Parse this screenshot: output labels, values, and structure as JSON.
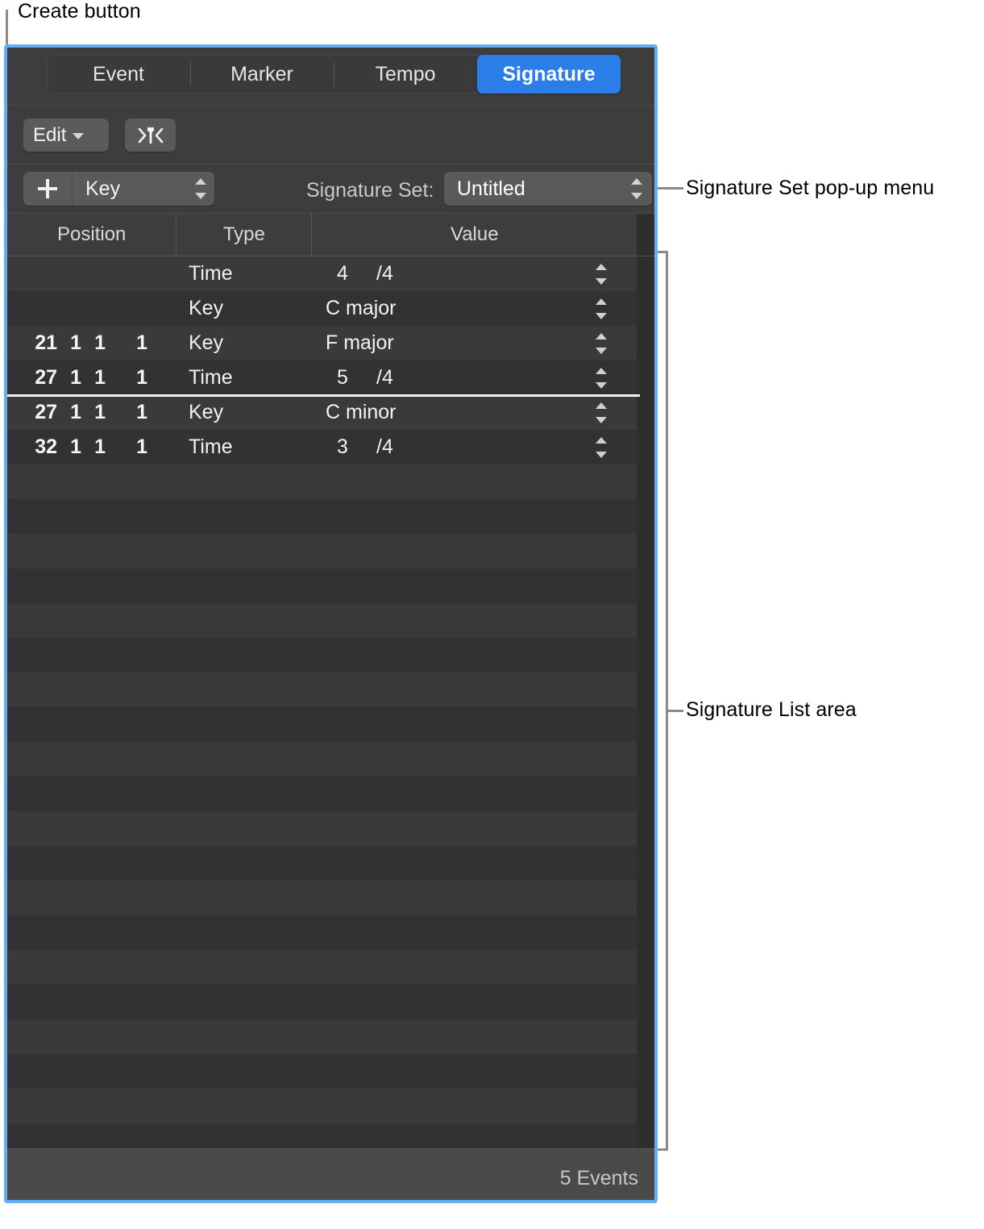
{
  "callouts": {
    "create_button": "Create button",
    "signature_set_menu": "Signature Set pop-up menu",
    "signature_list_area": "Signature List area"
  },
  "tabs": [
    {
      "label": "Event",
      "selected": false
    },
    {
      "label": "Marker",
      "selected": false
    },
    {
      "label": "Tempo",
      "selected": false
    },
    {
      "label": "Signature",
      "selected": true
    }
  ],
  "toolbar": {
    "edit_label": "Edit",
    "edit_chevron_icon": "chevron-down-icon",
    "snap_to_playhead_icon": "note-between-arrows-icon"
  },
  "create_bar": {
    "plus_icon": "plus-icon",
    "event_type": "Key",
    "event_type_stepper_icon": "stepper-up-down-icon",
    "signature_set_label": "Signature Set:",
    "signature_set_value": "Untitled",
    "signature_set_stepper_icon": "stepper-up-down-icon"
  },
  "list": {
    "columns": [
      "Position",
      "Type",
      "Value"
    ],
    "rows": [
      {
        "bar": "",
        "beat": "",
        "div": "",
        "ticks": "",
        "type": "Time",
        "value_kind": "time",
        "numerator": "4",
        "denominator": "/4"
      },
      {
        "bar": "",
        "beat": "",
        "div": "",
        "ticks": "",
        "type": "Key",
        "value_kind": "key",
        "value": "C major"
      },
      {
        "bar": "21",
        "beat": "1",
        "div": "1",
        "ticks": "1",
        "type": "Key",
        "value_kind": "key",
        "value": "F major"
      },
      {
        "bar": "27",
        "beat": "1",
        "div": "1",
        "ticks": "1",
        "type": "Time",
        "value_kind": "time",
        "numerator": "5",
        "denominator": "/4"
      },
      {
        "bar": "27",
        "beat": "1",
        "div": "1",
        "ticks": "1",
        "type": "Key",
        "value_kind": "key",
        "value": "C minor"
      },
      {
        "bar": "32",
        "beat": "1",
        "div": "1",
        "ticks": "1",
        "type": "Time",
        "value_kind": "time",
        "numerator": "3",
        "denominator": "/4"
      }
    ],
    "playhead_after_row_index": 3,
    "empty_row_count": 20
  },
  "footer": {
    "event_count": "5 Events"
  },
  "colors": {
    "accent": "#2b7ee8",
    "window_border": "#63aef5",
    "window_bg": "#3d3d3d",
    "row_odd": "#3a3a3a",
    "row_even": "#323232",
    "footer_bg": "#4a4a4a",
    "playhead": "#f0f0f0"
  }
}
